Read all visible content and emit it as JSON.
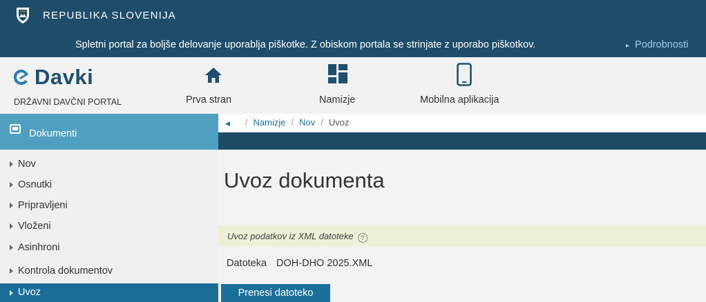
{
  "gov": {
    "title": "REPUBLIKA SLOVENIJA",
    "cookie_text": "Spletni portal za boljše delovanje uporablja piškotke. Z obiskom portala se strinjate z uporabo piškotkov.",
    "cookie_link": "Podrobnosti",
    "crest_icon": "coat-of-arms-icon"
  },
  "portal": {
    "logo_name": "Davki",
    "logo_sub": "DRŽAVNI DAVČNI PORTAL",
    "nav": [
      {
        "label": "Prva stran",
        "icon": "home-icon"
      },
      {
        "label": "Namizje",
        "icon": "dashboard-icon"
      },
      {
        "label": "Mobilna aplikacija",
        "icon": "mobile-phone-icon"
      }
    ]
  },
  "sidebar": {
    "header": "Dokumenti",
    "items": [
      {
        "label": "Nov"
      },
      {
        "label": "Osnutki"
      },
      {
        "label": "Pripravljeni"
      },
      {
        "label": "Vloženi"
      },
      {
        "label": "Asinhroni"
      },
      {
        "label": "Kontrola dokumentov"
      },
      {
        "label": "Uvoz",
        "active": true
      }
    ]
  },
  "breadcrumb": {
    "items": [
      "Namizje",
      "Nov",
      "Uvoz"
    ]
  },
  "main": {
    "title": "Uvoz dokumenta",
    "info": "Uvoz podatkov iz XML datoteke",
    "file_label": "Datoteka",
    "file_value": "DOH-DHO 2025.XML",
    "upload_button": "Prenesi datoteko"
  },
  "colors": {
    "gov_bar": "#1e4d6b",
    "accent": "#1a6f99",
    "sidebar_head": "#4f9fc0",
    "info_bg": "#f0efd8"
  }
}
